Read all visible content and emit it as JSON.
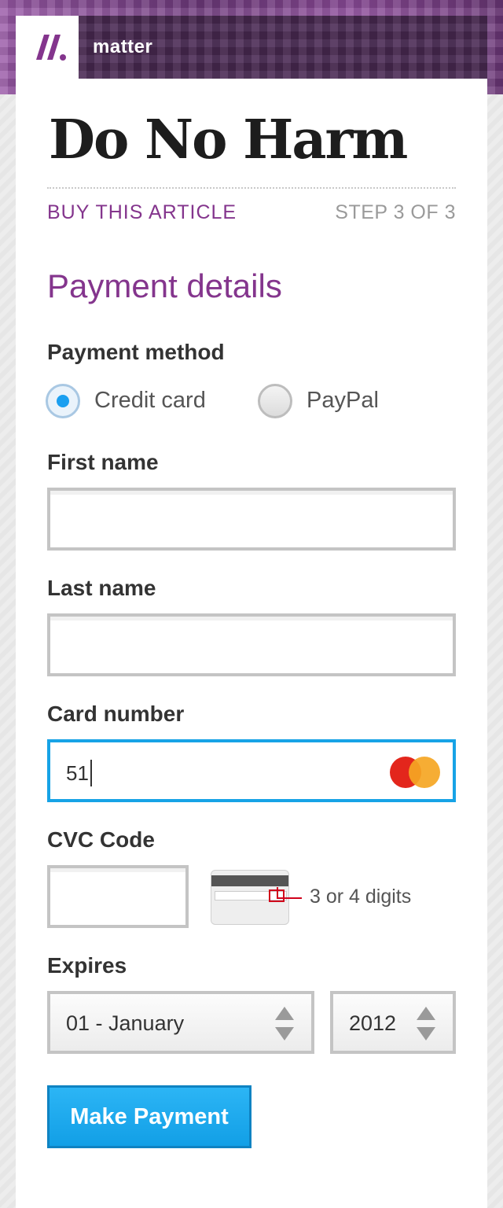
{
  "header": {
    "brand": "matter",
    "article_title": "Do No Harm"
  },
  "checkout": {
    "buy_label": "BUY THIS ARTICLE",
    "step_label": "STEP 3 OF 3",
    "section_title": "Payment details"
  },
  "payment_method": {
    "label": "Payment method",
    "options": [
      {
        "label": "Credit card",
        "selected": true
      },
      {
        "label": "PayPal",
        "selected": false
      }
    ]
  },
  "fields": {
    "first_name": {
      "label": "First name",
      "value": ""
    },
    "last_name": {
      "label": "Last name",
      "value": ""
    },
    "card_number": {
      "label": "Card number",
      "value": "51",
      "card_brand_icon": "mastercard-icon"
    },
    "cvc": {
      "label": "CVC Code",
      "value": "",
      "hint": "3 or 4 digits"
    },
    "expires": {
      "label": "Expires",
      "month": "01 - January",
      "year": "2012"
    }
  },
  "actions": {
    "submit_label": "Make Payment"
  },
  "colors": {
    "accent_purple": "#84358d",
    "button_blue": "#1aa7ee",
    "focus_blue": "#17a3e6"
  }
}
